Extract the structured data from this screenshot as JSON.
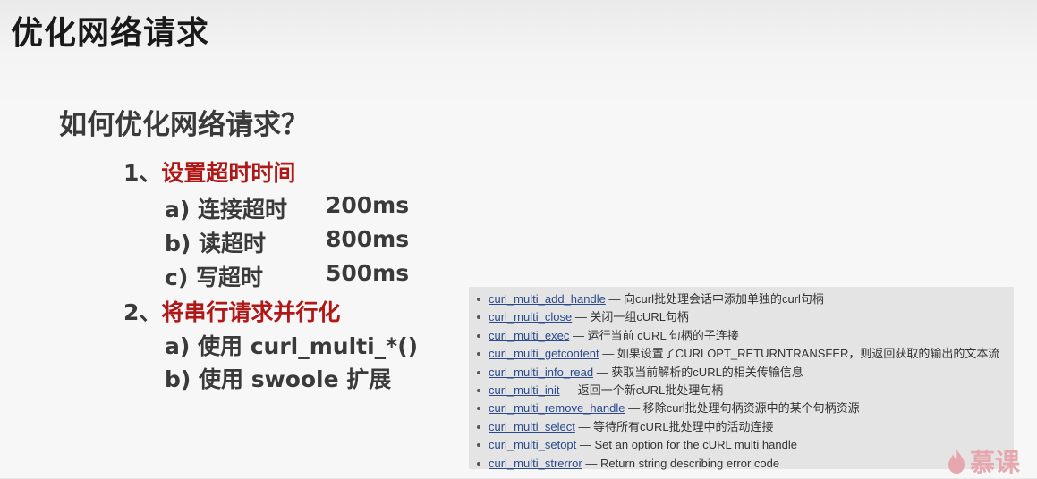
{
  "title": "优化网络请求",
  "question": "如何优化网络请求？",
  "points": [
    {
      "num": "1、",
      "text": "设置超时时间",
      "subs": [
        {
          "label": "a) 连接超时",
          "value": "200ms"
        },
        {
          "label": "b) 读超时",
          "value": "800ms"
        },
        {
          "label": "c)  写超时",
          "value": "500ms"
        }
      ]
    },
    {
      "num": "2、",
      "text": "将串行请求并行化",
      "subs": [
        {
          "label": "a) 使用 curl_multi_*()"
        },
        {
          "label": "b) 使用 swoole 扩展"
        }
      ]
    }
  ],
  "functions": [
    {
      "name": "curl_multi_add_handle",
      "desc": " — 向curl批处理会话中添加单独的curl句柄"
    },
    {
      "name": "curl_multi_close",
      "desc": " — 关闭一组cURL句柄"
    },
    {
      "name": "curl_multi_exec",
      "desc": " — 运行当前 cURL 句柄的子连接"
    },
    {
      "name": "curl_multi_getcontent",
      "desc": " — 如果设置了CURLOPT_RETURNTRANSFER，则返回获取的输出的文本流"
    },
    {
      "name": "curl_multi_info_read",
      "desc": " — 获取当前解析的cURL的相关传输信息"
    },
    {
      "name": "curl_multi_init",
      "desc": " — 返回一个新cURL批处理句柄"
    },
    {
      "name": "curl_multi_remove_handle",
      "desc": " — 移除curl批处理句柄资源中的某个句柄资源"
    },
    {
      "name": "curl_multi_select",
      "desc": " — 等待所有cURL批处理中的活动连接"
    },
    {
      "name": "curl_multi_setopt",
      "desc": " — Set an option for the cURL multi handle"
    },
    {
      "name": "curl_multi_strerror",
      "desc": " — Return string describing error code"
    }
  ],
  "brand": {
    "text": "慕课",
    "color": "#e6a7ae"
  }
}
